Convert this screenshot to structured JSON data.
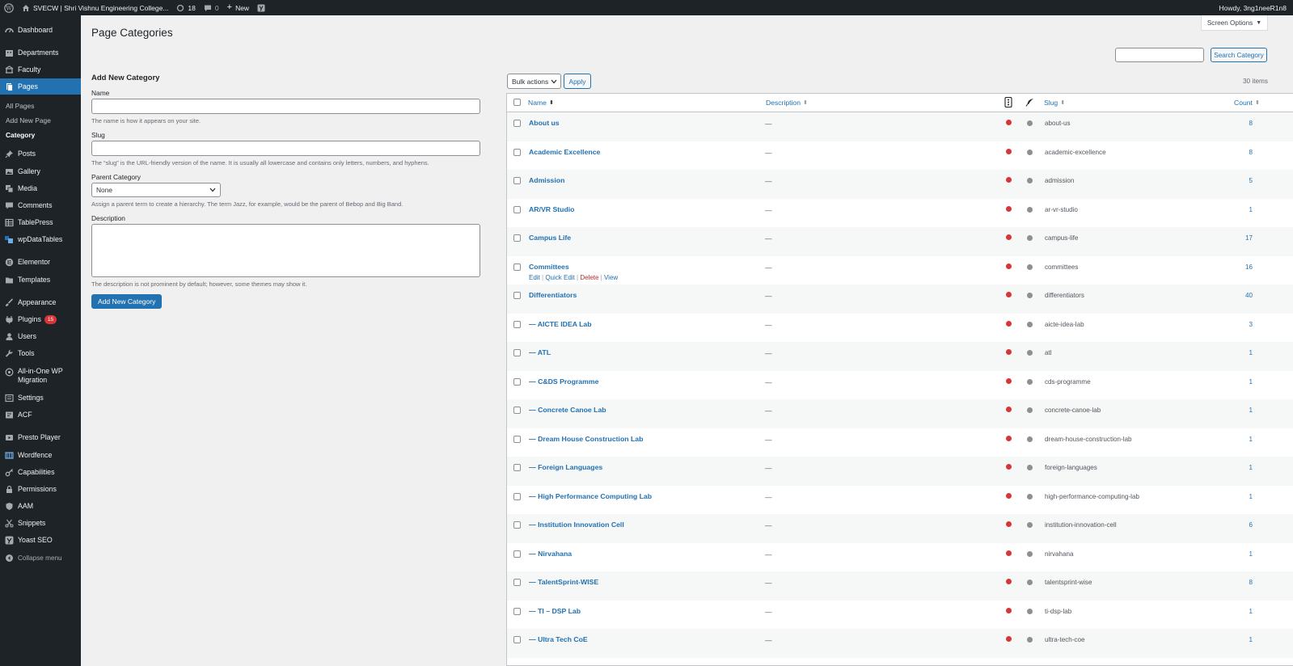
{
  "adminbar": {
    "site_name": "SVECW | Shri Vishnu Engineering College...",
    "updates_count": "18",
    "comments_count": "0",
    "new_label": "New",
    "howdy": "Howdy, 3ng1neeR1n8"
  },
  "sidebar": {
    "dashboard": "Dashboard",
    "departments": "Departments",
    "faculty": "Faculty",
    "pages": "Pages",
    "all_pages": "All Pages",
    "add_new_page": "Add New Page",
    "category": "Category",
    "posts": "Posts",
    "gallery": "Gallery",
    "media": "Media",
    "comments": "Comments",
    "tablepress": "TablePress",
    "wpdatatables": "wpDataTables",
    "elementor": "Elementor",
    "templates": "Templates",
    "appearance": "Appearance",
    "plugins": "Plugins",
    "plugins_badge": "15",
    "users": "Users",
    "tools": "Tools",
    "migration": "All-in-One WP Migration",
    "settings": "Settings",
    "acf": "ACF",
    "presto": "Presto Player",
    "wordfence": "Wordfence",
    "capabilities": "Capabilities",
    "permissions": "Permissions",
    "aam": "AAM",
    "snippets": "Snippets",
    "yoast": "Yoast SEO",
    "collapse": "Collapse menu"
  },
  "page": {
    "title": "Page Categories",
    "screen_options": "Screen Options",
    "search_button": "Search Category",
    "search_value": ""
  },
  "form": {
    "heading": "Add New Category",
    "name_label": "Name",
    "name_help": "The name is how it appears on your site.",
    "slug_label": "Slug",
    "slug_help": "The “slug” is the URL-friendly version of the name. It is usually all lowercase and contains only letters, numbers, and hyphens.",
    "parent_label": "Parent Category",
    "parent_value": "None",
    "parent_help": "Assign a parent term to create a hierarchy. The term Jazz, for example, would be the parent of Bebop and Big Band.",
    "desc_label": "Description",
    "desc_help": "The description is not prominent by default; however, some themes may show it.",
    "submit": "Add New Category"
  },
  "list": {
    "bulk_actions": "Bulk actions",
    "apply": "Apply",
    "items_count": "30 items",
    "columns": {
      "name": "Name",
      "description": "Description",
      "slug": "Slug",
      "count": "Count"
    },
    "row_actions": {
      "edit": "Edit",
      "quick_edit": "Quick Edit",
      "delete": "Delete",
      "view": "View"
    },
    "rows": [
      {
        "name": "About us",
        "desc": "—",
        "slug": "about-us",
        "count": "8"
      },
      {
        "name": "Academic Excellence",
        "desc": "—",
        "slug": "academic-excellence",
        "count": "8"
      },
      {
        "name": "Admission",
        "desc": "—",
        "slug": "admission",
        "count": "5"
      },
      {
        "name": "AR/VR Studio",
        "desc": "—",
        "slug": "ar-vr-studio",
        "count": "1"
      },
      {
        "name": "Campus Life",
        "desc": "—",
        "slug": "campus-life",
        "count": "17"
      },
      {
        "name": "Committees",
        "desc": "—",
        "slug": "committees",
        "count": "16"
      },
      {
        "name": "Differentiators",
        "desc": "—",
        "slug": "differentiators",
        "count": "40"
      },
      {
        "name": "— AICTE IDEA Lab",
        "desc": "—",
        "slug": "aicte-idea-lab",
        "count": "3"
      },
      {
        "name": "— ATL",
        "desc": "—",
        "slug": "atl",
        "count": "1"
      },
      {
        "name": "— C&DS Programme",
        "desc": "—",
        "slug": "cds-programme",
        "count": "1"
      },
      {
        "name": "— Concrete Canoe Lab",
        "desc": "—",
        "slug": "concrete-canoe-lab",
        "count": "1"
      },
      {
        "name": "— Dream House Construction Lab",
        "desc": "—",
        "slug": "dream-house-construction-lab",
        "count": "1"
      },
      {
        "name": "— Foreign Languages",
        "desc": "—",
        "slug": "foreign-languages",
        "count": "1"
      },
      {
        "name": "— High Performance Computing Lab",
        "desc": "—",
        "slug": "high-performance-computing-lab",
        "count": "1"
      },
      {
        "name": "— Institution Innovation Cell",
        "desc": "—",
        "slug": "institution-innovation-cell",
        "count": "6"
      },
      {
        "name": "— Nirvahana",
        "desc": "—",
        "slug": "nirvahana",
        "count": "1"
      },
      {
        "name": "— TalentSprint-WISE",
        "desc": "—",
        "slug": "talentsprint-wise",
        "count": "8"
      },
      {
        "name": "— TI – DSP Lab",
        "desc": "—",
        "slug": "ti-dsp-lab",
        "count": "1"
      },
      {
        "name": "— Ultra Tech CoE",
        "desc": "—",
        "slug": "ultra-tech-coe",
        "count": "1"
      }
    ]
  }
}
